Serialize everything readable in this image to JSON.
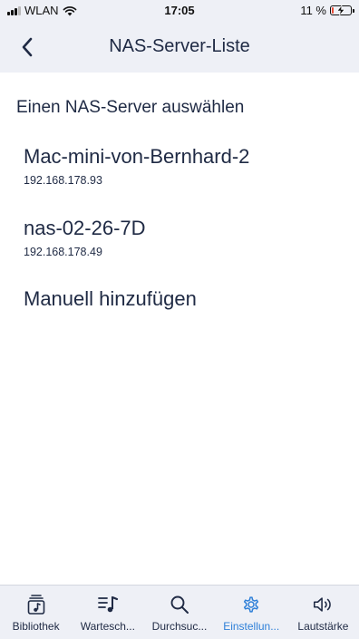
{
  "status_bar": {
    "carrier": "WLAN",
    "time": "17:05",
    "battery_percent_label": "11 %",
    "battery_level": 0.11,
    "battery_color": "#e94b35"
  },
  "nav": {
    "title": "NAS-Server-Liste",
    "back_icon": "chevron-left-icon"
  },
  "content": {
    "heading": "Einen NAS-Server auswählen",
    "servers": [
      {
        "name": "Mac-mini-von-Bernhard-2",
        "ip": "192.168.178.93"
      },
      {
        "name": "nas-02-26-7D",
        "ip": "192.168.178.49"
      }
    ],
    "manual_add_label": "Manuell hinzufügen"
  },
  "tab_bar": {
    "active_color": "#2f80d8",
    "tabs": [
      {
        "label": "Bibliothek",
        "icon": "library-icon",
        "active": false
      },
      {
        "label": "Wartesch...",
        "icon": "queue-icon",
        "active": false
      },
      {
        "label": "Durchsuc...",
        "icon": "search-icon",
        "active": false
      },
      {
        "label": "Einstellun...",
        "icon": "gear-icon",
        "active": true
      },
      {
        "label": "Lautstärke",
        "icon": "speaker-icon",
        "active": false
      }
    ]
  }
}
